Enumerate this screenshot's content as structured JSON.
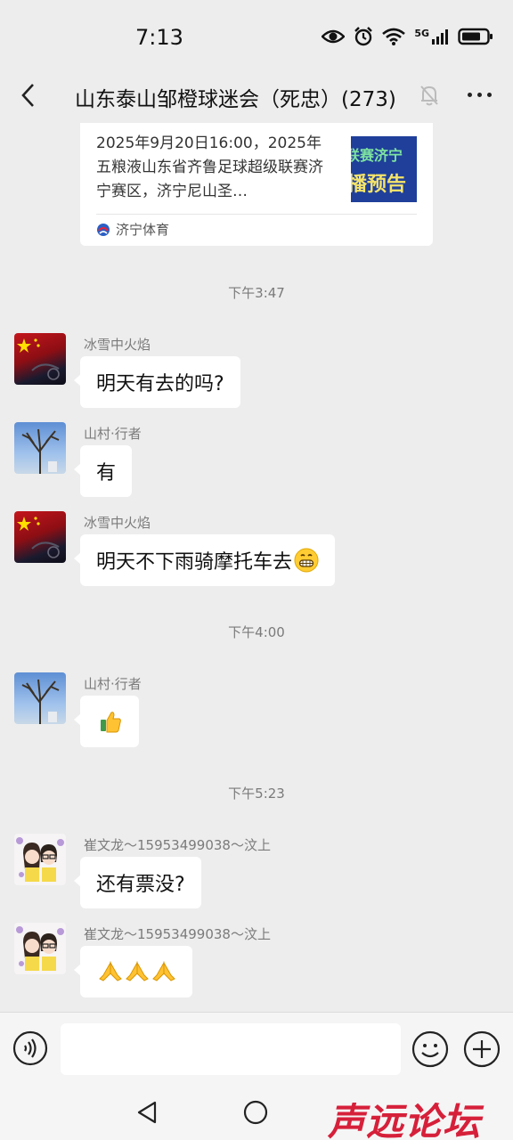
{
  "status": {
    "time": "7:13",
    "network": "5G",
    "icons": [
      "eye-icon",
      "alarm-icon",
      "wifi-icon",
      "signal-icon",
      "battery-icon"
    ]
  },
  "header": {
    "title": "山东泰山邹橙球迷会（死忠）(273)",
    "icons": [
      "back-arrow-icon",
      "mute-bell-icon",
      "more-dots-icon"
    ]
  },
  "card": {
    "text": "2025年9月20日16:00，2025年五粮液山东省齐鲁足球超级联赛济宁赛区，济宁尼山圣…",
    "thumb_line1": "联赛济宁",
    "thumb_line2": "播预告",
    "source": "济宁体育"
  },
  "messages": [
    {
      "time": "下午3:47"
    },
    {
      "sender": "冰雪中火焰",
      "text": "明天有去的吗?",
      "avatar": "flag-avatar"
    },
    {
      "sender": "山村·行者",
      "text": "有",
      "avatar": "tree-avatar"
    },
    {
      "sender": "冰雪中火焰",
      "text": "明天不下雨骑摩托车去",
      "emoji": "grin-emoji",
      "avatar": "flag-avatar"
    },
    {
      "time": "下午4:00"
    },
    {
      "sender": "山村·行者",
      "emoji": "thumbs-up-emoji",
      "avatar": "tree-avatar"
    },
    {
      "time": "下午5:23"
    },
    {
      "sender": "崔文龙～15953499038～汶上",
      "text": "还有票没?",
      "avatar": "couple-avatar"
    },
    {
      "sender": "崔文龙～15953499038～汶上",
      "emoji": "folded-hands-emoji x3",
      "avatar": "couple-avatar"
    }
  ],
  "input": {
    "value": "",
    "icons": [
      "voice-icon",
      "emoji-icon",
      "plus-icon"
    ]
  },
  "watermark": "声远论坛",
  "colors": {
    "background": "#ededed",
    "bubble": "#ffffff",
    "watermark": "#d6203a"
  }
}
